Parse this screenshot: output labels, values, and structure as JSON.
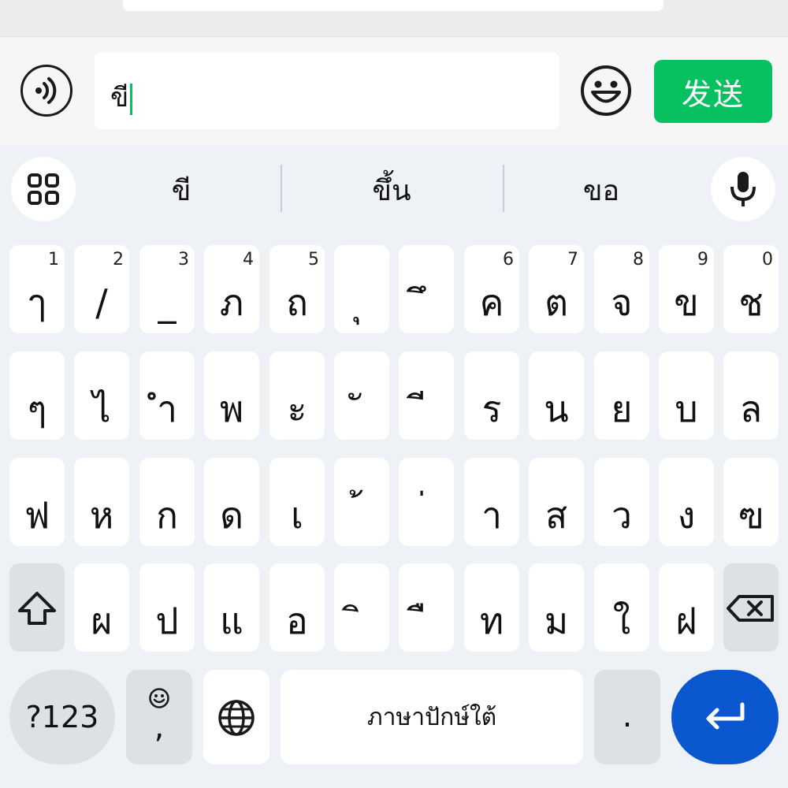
{
  "input": {
    "value": "ขี"
  },
  "send_label": "发送",
  "suggestions": [
    "ขี",
    "ขึ้น",
    "ขอ"
  ],
  "rows": [
    [
      {
        "c": "ๅ",
        "n": "1"
      },
      {
        "c": "/",
        "n": "2"
      },
      {
        "c": "_",
        "n": "3"
      },
      {
        "c": "ภ",
        "n": "4"
      },
      {
        "c": "ถ",
        "n": "5"
      },
      {
        "c": "ุ",
        "n": ""
      },
      {
        "c": "ึ",
        "n": ""
      },
      {
        "c": "ค",
        "n": "6"
      },
      {
        "c": "ต",
        "n": "7"
      },
      {
        "c": "จ",
        "n": "8"
      },
      {
        "c": "ข",
        "n": "9"
      },
      {
        "c": "ช",
        "n": "0"
      }
    ],
    [
      {
        "c": "ๆ"
      },
      {
        "c": "ไ"
      },
      {
        "c": "ำ"
      },
      {
        "c": "พ"
      },
      {
        "c": "ะ"
      },
      {
        "c": "ั"
      },
      {
        "c": "ี"
      },
      {
        "c": "ร"
      },
      {
        "c": "น"
      },
      {
        "c": "ย"
      },
      {
        "c": "บ"
      },
      {
        "c": "ล"
      }
    ],
    [
      {
        "c": "ฟ"
      },
      {
        "c": "ห"
      },
      {
        "c": "ก"
      },
      {
        "c": "ด"
      },
      {
        "c": "เ"
      },
      {
        "c": "้"
      },
      {
        "c": "่"
      },
      {
        "c": "า"
      },
      {
        "c": "ส"
      },
      {
        "c": "ว"
      },
      {
        "c": "ง"
      },
      {
        "c": "ฃ"
      }
    ],
    [
      {
        "c": "ผ"
      },
      {
        "c": "ป"
      },
      {
        "c": "แ"
      },
      {
        "c": "อ"
      },
      {
        "c": "ิ"
      },
      {
        "c": "ื"
      },
      {
        "c": "ท"
      },
      {
        "c": "ม"
      },
      {
        "c": "ใ"
      },
      {
        "c": "ฝ"
      }
    ]
  ],
  "bottom": {
    "symbols_label": "?123",
    "comma_label": ",",
    "space_label": "ภาษาปักษ์ใต้",
    "period_label": "."
  },
  "colors": {
    "accent": "#07c160",
    "enter": "#0b57d0"
  }
}
